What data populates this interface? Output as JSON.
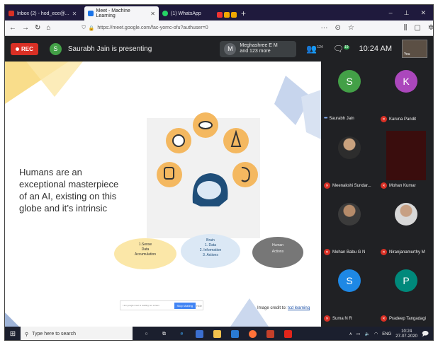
{
  "browser": {
    "tabs": [
      {
        "label": "Inbox (2) - hod_ece@...",
        "color": "#d93025"
      },
      {
        "label": "Meet - Machine Learning",
        "color": "#1a73e8"
      },
      {
        "label": "(1) WhatsApp",
        "color": "#25d366"
      }
    ],
    "url": "https://meet.google.com/fac-yomc-ofu?authuser=0",
    "url_host": "meet.google.com"
  },
  "meet": {
    "rec_label": "REC",
    "presenter_initial": "S",
    "presenter_text": "Saurabh Jain is presenting",
    "others_initial": "M",
    "others_line1": "Meghashree E M",
    "others_line2": "and 123 more",
    "people_count": "124",
    "chat_badge": "19",
    "time": "10:24 AM",
    "self_label": "You"
  },
  "slide": {
    "text": "Humans are an exceptional masterpiece of an AI, existing on this globe and it’s intrinsic",
    "cloud_left": "1.Sense\nData\nAccumulation",
    "cloud_mid": "Brain\n1. Data\n2. Information\n3. Actions",
    "cloud_right": "Human\nActions",
    "credit_label": "Image credit to:",
    "credit_link": "tcd learning",
    "search_placeholder": "I am google meet & reading our screen",
    "search_button": "Stop sharing",
    "search_extra": "Hide"
  },
  "participants": [
    {
      "name": "Saurabh Jain",
      "initial": "S",
      "color": "#43a047",
      "mic": "speaking"
    },
    {
      "name": "Karuna Pandit",
      "initial": "K",
      "color": "#ab47bc",
      "mic": "muted"
    },
    {
      "name": "Meenakshi Sundar...",
      "initial": "",
      "color": "#3a3a3a",
      "mic": "muted"
    },
    {
      "name": "Mohan Kumar",
      "initial": "",
      "color": "#3a0d0d",
      "mic": "muted"
    },
    {
      "name": "Mohan Babu G N",
      "initial": "",
      "color": "#4a4a4a",
      "mic": "muted"
    },
    {
      "name": "Niranjanamurthy M",
      "initial": "",
      "color": "#4a4a4a",
      "mic": "muted"
    },
    {
      "name": "Suma N R",
      "initial": "S",
      "color": "#1e88e5",
      "mic": "muted"
    },
    {
      "name": "Pradeep Tangadagi",
      "initial": "P",
      "color": "#00897b",
      "mic": "muted"
    }
  ],
  "taskbar": {
    "search_placeholder": "Type here to search",
    "lang": "ENG",
    "time": "10:24",
    "date": "27-07-2020"
  }
}
